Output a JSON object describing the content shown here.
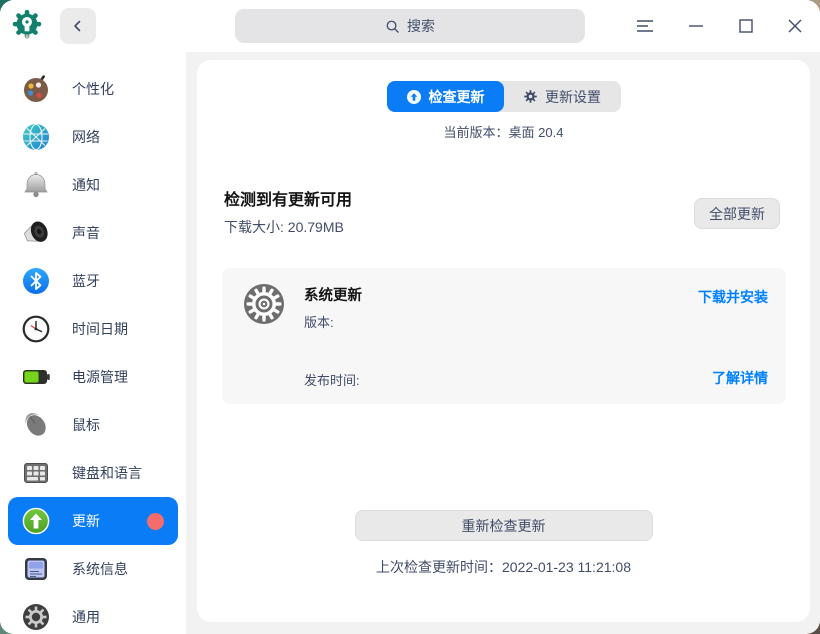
{
  "titlebar": {
    "search_placeholder": "搜索"
  },
  "sidebar": {
    "items": [
      {
        "label": "个性化",
        "icon": "palette-icon"
      },
      {
        "label": "网络",
        "icon": "network-icon"
      },
      {
        "label": "通知",
        "icon": "bell-icon"
      },
      {
        "label": "声音",
        "icon": "speaker-icon"
      },
      {
        "label": "蓝牙",
        "icon": "bluetooth-icon"
      },
      {
        "label": "时间日期",
        "icon": "clock-icon"
      },
      {
        "label": "电源管理",
        "icon": "battery-icon"
      },
      {
        "label": "鼠标",
        "icon": "mouse-icon"
      },
      {
        "label": "键盘和语言",
        "icon": "keyboard-icon"
      },
      {
        "label": "更新",
        "icon": "update-icon",
        "selected": true,
        "badge": true
      },
      {
        "label": "系统信息",
        "icon": "system-info-icon"
      },
      {
        "label": "通用",
        "icon": "gear-icon"
      }
    ]
  },
  "main": {
    "tabs": [
      {
        "label": "检查更新",
        "active": true
      },
      {
        "label": "更新设置",
        "active": false
      }
    ],
    "current_version": "当前版本：桌面 20.4",
    "summary": {
      "title": "检测到有更新可用",
      "download_size": "下载大小: 20.79MB",
      "update_all_label": "全部更新"
    },
    "update_card": {
      "title": "系统更新",
      "version_label": "版本:",
      "release_label": "发布时间:",
      "download_install_label": "下载并安装",
      "details_label": "了解详情"
    },
    "recheck_label": "重新检查更新",
    "last_check": "上次检查更新时间：2022-01-23 11:21:08"
  },
  "colors": {
    "accent": "#0a7cf5",
    "link": "#0081ff",
    "badge": "#f56c6c",
    "update_green": "#5cb030"
  }
}
